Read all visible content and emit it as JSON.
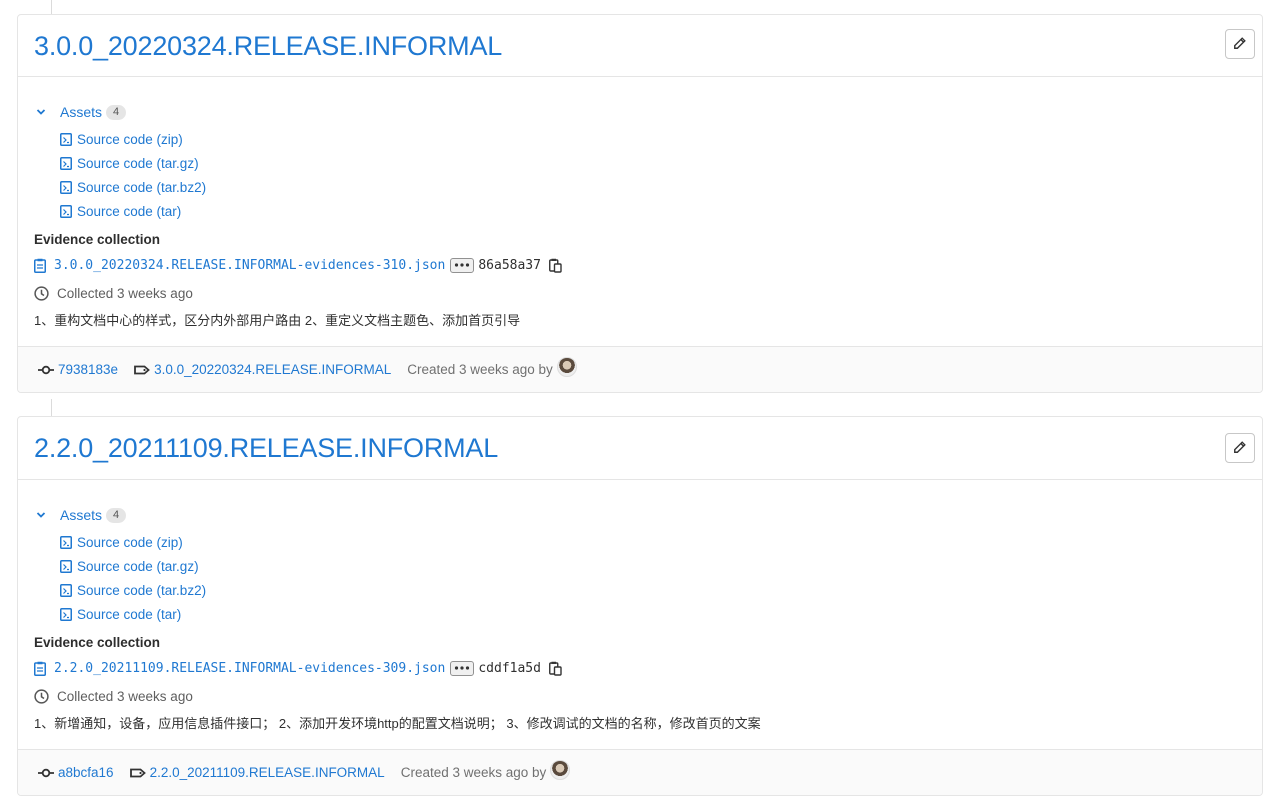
{
  "releases": [
    {
      "title": "3.0.0_20220324.RELEASE.INFORMAL",
      "assets_label": "Assets",
      "assets_count": "4",
      "assets": [
        "Source code (zip)",
        "Source code (tar.gz)",
        "Source code (tar.bz2)",
        "Source code (tar)"
      ],
      "evidence_heading": "Evidence collection",
      "evidence_file": "3.0.0_20220324.RELEASE.INFORMAL-evidences-310.json",
      "evidence_hash": "86a58a37",
      "collected": "Collected 3 weeks ago",
      "description": "1、重构文档中心的样式，区分内外部用户路由 2、重定义文档主题色、添加首页引导",
      "commit": "7938183e",
      "tag": "3.0.0_20220324.RELEASE.INFORMAL",
      "created": "Created 3 weeks ago by"
    },
    {
      "title": "2.2.0_20211109.RELEASE.INFORMAL",
      "assets_label": "Assets",
      "assets_count": "4",
      "assets": [
        "Source code (zip)",
        "Source code (tar.gz)",
        "Source code (tar.bz2)",
        "Source code (tar)"
      ],
      "evidence_heading": "Evidence collection",
      "evidence_file": "2.2.0_20211109.RELEASE.INFORMAL-evidences-309.json",
      "evidence_hash": "cddf1a5d",
      "collected": "Collected 3 weeks ago",
      "description": "1、新增通知，设备，应用信息插件接口； 2、添加开发环境http的配置文档说明； 3、修改调试的文档的名称，修改首页的文案",
      "commit": "a8bcfa16",
      "tag": "2.2.0_20211109.RELEASE.INFORMAL",
      "created": "Created 3 weeks ago by"
    }
  ],
  "icons": {
    "edit": "pencil-icon",
    "chevron": "chevron-down-icon",
    "archive": "doc-code-icon",
    "evidence": "clipboard-icon",
    "ellipsis": "ellipsis-icon",
    "copy": "copy-to-clipboard-icon",
    "clock": "clock-icon",
    "commit": "commit-icon",
    "tag": "tag-icon"
  },
  "colors": {
    "link": "#1f78d1",
    "text": "#303030",
    "muted": "#707070",
    "border": "#e5e5e5"
  }
}
